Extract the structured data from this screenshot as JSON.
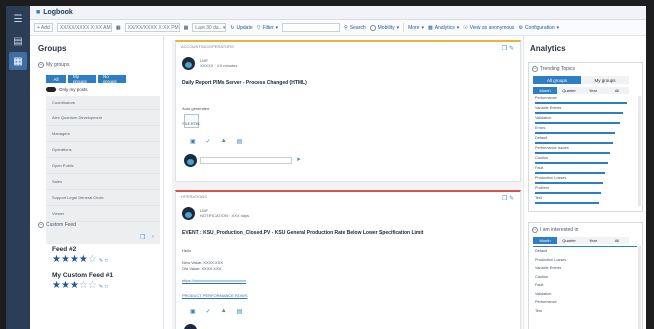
{
  "app": {
    "title": "Logbook"
  },
  "toolbar": {
    "add_label": "Add",
    "date_from_placeholder": "XX/XX/XXXX X:XX AM",
    "date_to_placeholder": "XX/XX/XXXX X:XX PM",
    "range_value": "Last 30 da...",
    "update_label": "Update",
    "filter_label": "Filter",
    "search_label": "Search",
    "mobility_label": "Mobility",
    "more_label": "More",
    "analytics_label": "Analytics",
    "view_as_label": "View as anonymous",
    "configuration_label": "Configuration"
  },
  "groups": {
    "title": "Groups",
    "my_groups_label": "My groups",
    "segments": [
      "All",
      "My groups",
      "No groups"
    ],
    "toggle_label": "Only my posts",
    "items": [
      "Coordinators",
      "Alex Quantum Development",
      "Managers",
      "Operations",
      "Open Public",
      "Sales",
      "Support Legal General Circle",
      "Viewer"
    ],
    "custom_feed_label": "Custom Feed",
    "feeds": [
      {
        "name": "Feed #2",
        "rating": 4,
        "max": 5
      },
      {
        "name": "My Custom Feed #1",
        "rating": 3,
        "max": 5
      }
    ]
  },
  "feed": {
    "cards": [
      {
        "tag": "ACCOUNTING/OPERATORS",
        "author": "LMF",
        "meta": "XXXXX · XX minutes",
        "subject": "Daily Report PIMs Server - Process Changed (HTML)",
        "body": "Auto generated",
        "attachment": "FILE.HTML",
        "accent": "#e8b341"
      },
      {
        "tag": "OPERATIONS",
        "author": "LMF",
        "meta": "NOTIFICATION · XXX days",
        "subject": "EVENT : KSU_Production_Closed.PV - KSU General Production Rate Below Lower Specification Limit",
        "body_lines": [
          "Hello",
          "New Value: XXXX.XXX",
          "Old Value: XXXX.XXX"
        ],
        "link1": "https://xxxxxxxxxxxxxxxxxxxxxxxxxx",
        "link2": "PRODUCT PERFORMANCE ROWS",
        "accent": "#d9534f"
      }
    ]
  },
  "analytics": {
    "title": "Analytics",
    "trending_label": "Trending Topics",
    "trend_tabs": [
      "All groups",
      "My groups"
    ],
    "period_tabs": [
      "Month",
      "Quarter",
      "Year",
      "All"
    ],
    "trending": [
      {
        "label": "Performance",
        "pct": 0.92
      },
      {
        "label": "Variable Events",
        "pct": 0.88
      },
      {
        "label": "Validation",
        "pct": 0.85
      },
      {
        "label": "Errors",
        "pct": 0.8
      },
      {
        "label": "Default",
        "pct": 0.78
      },
      {
        "label": "Performance Issues",
        "pct": 0.75
      },
      {
        "label": "Caution",
        "pct": 0.73
      },
      {
        "label": "Fault",
        "pct": 0.7
      },
      {
        "label": "Production Losses",
        "pct": 0.68
      },
      {
        "label": "Problem",
        "pct": 0.66
      },
      {
        "label": "Test",
        "pct": 0.64
      }
    ],
    "interested_label": "I am interested in",
    "interested_period_tabs": [
      "Month",
      "Quarter",
      "Year",
      "All"
    ],
    "interested": [
      "Default",
      "Production Losses",
      "Variable Events",
      "Caution",
      "Fault",
      "Validation",
      "Performance",
      "Test"
    ]
  },
  "colors": {
    "accent": "#2e7ec4",
    "rail": "#2b3e55"
  }
}
